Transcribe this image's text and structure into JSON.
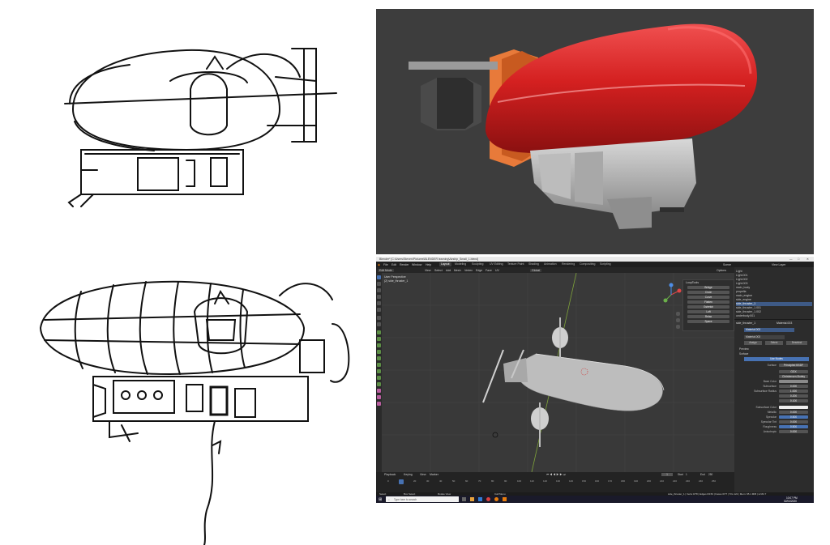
{
  "window": {
    "title": "Blender* [C:\\Users\\Steven\\Pictures\\BLENDER learning\\Airship_Small_1.blend]",
    "controls": [
      "—",
      "□",
      "✕"
    ]
  },
  "menu": {
    "items": [
      "File",
      "Edit",
      "Render",
      "Window",
      "Help"
    ],
    "workspaces": [
      "Layout",
      "Modeling",
      "Sculpting",
      "UV Editing",
      "Texture Paint",
      "Shading",
      "Animation",
      "Rendering",
      "Compositing",
      "Scripting"
    ],
    "active_workspace": "Layout",
    "scene": "Scene",
    "view_layer": "View Layer"
  },
  "header": {
    "mode": "Edit Mode",
    "view_items": [
      "View",
      "Select",
      "Add",
      "Mesh",
      "Vertex",
      "Edge",
      "Face",
      "UV"
    ],
    "orientation": "Global",
    "options": "Options"
  },
  "viewport": {
    "info_line1": "User Perspective",
    "info_line2": "(2) side_thruster_1"
  },
  "loop_tools": {
    "title": "LoopTools",
    "buttons": [
      "Bridge",
      "Circle",
      "Curve",
      "Flatten",
      "Gstretch",
      "Loft",
      "Relax",
      "Space"
    ]
  },
  "outliner": {
    "items": [
      "Light",
      "Light.001",
      "Light.002",
      "Light.003",
      "main_body",
      "propella",
      "main_engine",
      "side_engine",
      "side_thruster_1",
      "side_thruster_1.001",
      "side_thruster_1.002",
      "underbody.001"
    ],
    "selected_index": 8
  },
  "properties": {
    "object": "side_thruster_1",
    "material": "Material.003",
    "material_slot": "Material.003",
    "tabs": [
      "Assign",
      "Select",
      "Deselect"
    ],
    "preview_label": "Preview",
    "surface_label": "Surface",
    "use_nodes": "Use Nodes",
    "rows": [
      {
        "label": "Surface",
        "value": "Principled BSDF"
      },
      {
        "label": "",
        "value": "GGX"
      },
      {
        "label": "",
        "value": "Christensen-Burley"
      },
      {
        "label": "Base Color",
        "value": ""
      },
      {
        "label": "Subsurface",
        "value": "0.000"
      },
      {
        "label": "Subsurface Radius",
        "value": "1.000"
      },
      {
        "label": "",
        "value": "0.200"
      },
      {
        "label": "",
        "value": "0.100"
      },
      {
        "label": "Subsurface Color",
        "value": ""
      },
      {
        "label": "Metallic",
        "value": "0.000"
      },
      {
        "label": "Specular",
        "value": "0.500"
      },
      {
        "label": "Specular Tint",
        "value": "0.000"
      },
      {
        "label": "Roughness",
        "value": "0.500"
      },
      {
        "label": "Anisotropic",
        "value": "0.000"
      }
    ]
  },
  "timeline": {
    "menu": [
      "Playback",
      "Keying",
      "View",
      "Marker"
    ],
    "current_frame": "1",
    "start_label": "Start",
    "start": "1",
    "end_label": "End",
    "end": "250",
    "ticks": [
      "0",
      "10",
      "20",
      "30",
      "40",
      "50",
      "60",
      "70",
      "80",
      "90",
      "100",
      "110",
      "120",
      "130",
      "140",
      "150",
      "160",
      "170",
      "180",
      "190",
      "200",
      "210",
      "220",
      "230",
      "240",
      "250"
    ]
  },
  "status": {
    "left": [
      "Select",
      "Box Select",
      "Rotate View",
      "Call Menu"
    ],
    "right": "side_thruster_1 | Verts 0/78 | Edges 0/153 | Faces 0/77 | Tris 122 | Mem: 95.1 MiB | v2.82.7"
  },
  "taskbar": {
    "search_placeholder": "Type here to search",
    "time": "10:07 PM",
    "date": "02/04/2020"
  },
  "colors": {
    "blimp_red": "#d42020",
    "accent_blue": "#4772b3",
    "viewport_bg": "#393939",
    "render_bg": "#3d3d3d"
  }
}
